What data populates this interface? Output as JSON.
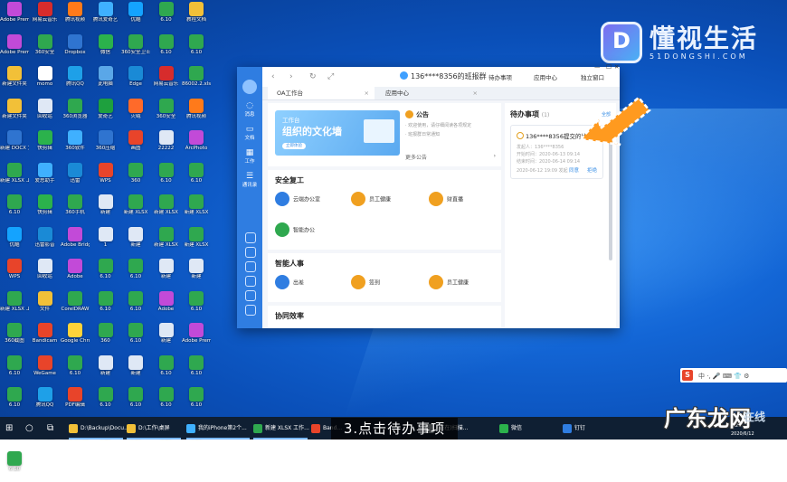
{
  "desktop": {
    "bg_color": "#1366d6",
    "icons": [
      [
        "Adobe Premiere",
        "#c24ad8"
      ],
      [
        "网易云音乐",
        "#d72c2c"
      ],
      [
        "腾讯视频",
        "#ff7a1a"
      ],
      [
        "腾讯爱奇艺",
        "#3fb0ff"
      ],
      [
        "优酷",
        "#14a3ff"
      ],
      [
        "6.10",
        "#2fa84f"
      ],
      [
        "教程文档",
        "#f2c038"
      ],
      [
        "Adobe Premiere",
        "#c24ad8"
      ],
      [
        "360安全",
        "#2fa84f"
      ],
      [
        "Dropbox",
        "#2f74d0"
      ],
      [
        "微信",
        "#2bb24c"
      ],
      [
        "360安全卫士",
        "#2fa84f"
      ],
      [
        "6.10",
        "#2fa84f"
      ],
      [
        "6.10",
        "#2fa84f"
      ],
      [
        "新建文件夹",
        "#f2c038"
      ],
      [
        "momo",
        "#ffffff"
      ],
      [
        "腾讯QQ",
        "#1ea0e8"
      ],
      [
        "此电脑",
        "#5aa7e8"
      ],
      [
        "Edge",
        "#1a8ad6"
      ],
      [
        "网易云音乐",
        "#d72c2c"
      ],
      [
        "86002.2.xlsx",
        "#2fa84f"
      ],
      [
        "新建文件夹",
        "#f2c038"
      ],
      [
        "回收站",
        "#dfe8f5"
      ],
      [
        "360浏览器",
        "#2fa84f"
      ],
      [
        "爱奇艺",
        "#1ea03e"
      ],
      [
        "火绒",
        "#ff6a2a"
      ],
      [
        "360安全",
        "#2fa84f"
      ],
      [
        "腾讯视频",
        "#ff7a1a"
      ],
      [
        "新建 DOCX 文档.docx",
        "#2f74d0"
      ],
      [
        "快剪辑",
        "#2bb24c"
      ],
      [
        "360软件",
        "#3fb0ff"
      ],
      [
        "360压缩",
        "#2f74d0"
      ],
      [
        "画图",
        "#e8442a"
      ],
      [
        "22222",
        "#dfe8f5"
      ],
      [
        "ArcPhoto",
        "#c24ad8"
      ],
      [
        "新建 XLSX 工作表",
        "#2fa84f"
      ],
      [
        "爱思助手",
        "#3fb0ff"
      ],
      [
        "迅雷",
        "#1a8ad6"
      ],
      [
        "WPS",
        "#e8442a"
      ],
      [
        "360",
        "#2fa84f"
      ],
      [
        "6.10",
        "#2fa84f"
      ],
      [
        "6.10",
        "#2fa84f"
      ],
      [
        "6.10",
        "#2fa84f"
      ],
      [
        "快剪辑",
        "#2bb24c"
      ],
      [
        "360手机",
        "#2fa84f"
      ],
      [
        "新建",
        "#dfe8f5"
      ],
      [
        "新建 XLSX",
        "#2fa84f"
      ],
      [
        "新建 XLSX",
        "#2fa84f"
      ],
      [
        "新建 XLSX",
        "#2fa84f"
      ],
      [
        "优酷",
        "#14a3ff"
      ],
      [
        "迅雷影音",
        "#1a8ad6"
      ],
      [
        "Adobe Bridge",
        "#c24ad8"
      ],
      [
        "1",
        "#dfe8f5"
      ],
      [
        "新建",
        "#dfe8f5"
      ],
      [
        "新建 XLSX",
        "#2fa84f"
      ],
      [
        "新建 XLSX",
        "#2fa84f"
      ],
      [
        "WPS",
        "#e8442a"
      ],
      [
        "回收站",
        "#dfe8f5"
      ],
      [
        "Adobe",
        "#c24ad8"
      ],
      [
        "6.10",
        "#2fa84f"
      ],
      [
        "6.10",
        "#2fa84f"
      ],
      [
        "新建",
        "#dfe8f5"
      ],
      [
        "新建",
        "#dfe8f5"
      ],
      [
        "新建 XLSX 工作表",
        "#2fa84f"
      ],
      [
        "文件",
        "#f2c038"
      ],
      [
        "CorelDRAW",
        "#2fa84f"
      ],
      [
        "6.10",
        "#2fa84f"
      ],
      [
        "6.10",
        "#2fa84f"
      ],
      [
        "Adobe",
        "#c24ad8"
      ],
      [
        "6.10",
        "#2fa84f"
      ],
      [
        "360截图",
        "#2fa84f"
      ],
      [
        "Bandicam",
        "#e8442a"
      ],
      [
        "Google Chrome",
        "#ffd33a"
      ],
      [
        "360",
        "#2fa84f"
      ],
      [
        "6.10",
        "#2fa84f"
      ],
      [
        "新建",
        "#dfe8f5"
      ],
      [
        "Adobe Premiere",
        "#c24ad8"
      ],
      [
        "6.10",
        "#2fa84f"
      ],
      [
        "WeGame",
        "#e8442a"
      ],
      [
        "6.10",
        "#2fa84f"
      ],
      [
        "新建",
        "#dfe8f5"
      ],
      [
        "新建",
        "#dfe8f5"
      ],
      [
        "6.10",
        "#2fa84f"
      ],
      [
        "6.10",
        "#2fa84f"
      ],
      [
        "6.10",
        "#2fa84f"
      ],
      [
        "腾讯QQ",
        "#1ea0e8"
      ],
      [
        "PDF编辑",
        "#e8442a"
      ],
      [
        "6.10",
        "#2fa84f"
      ],
      [
        "6.10",
        "#2fa84f"
      ],
      [
        "6.10",
        "#2fa84f"
      ],
      [
        "6.10",
        "#2fa84f"
      ],
      [
        "6.10",
        "#2fa84f"
      ],
      [
        "腾讯视频",
        "#ff7a1a"
      ],
      [
        "WPS Office",
        "#e8442a"
      ],
      [
        "6.10",
        "#2fa84f"
      ],
      [
        "6.10",
        "#2fa84f"
      ],
      [
        "6.10",
        "#2fa84f"
      ],
      [
        "6.10",
        "#2fa84f"
      ],
      [
        "6.10",
        "#2fa84f"
      ]
    ]
  },
  "watermark": {
    "logo_letter": "D",
    "title": "懂视生活",
    "domain": "51DONGSHI.COM"
  },
  "app": {
    "sidebar": [
      {
        "icon": "chat-icon",
        "label": "消息"
      },
      {
        "icon": "doc-icon",
        "label": "文档"
      },
      {
        "icon": "grid-icon",
        "label": "工作"
      },
      {
        "icon": "contacts-icon",
        "label": "通讯录"
      }
    ],
    "nav": {
      "back": "‹",
      "forward": "›",
      "refresh": "↻",
      "expand": "⤢"
    },
    "user": "136****8356的班报群",
    "toolbar": {
      "todo": "待办事项",
      "apps": "应用中心",
      "standalone": "独立窗口"
    },
    "window": {
      "minimize": "—",
      "maximize": "☐",
      "close": "✕"
    },
    "tabs": [
      {
        "label": "OA工作台",
        "active": true
      },
      {
        "label": "应用中心",
        "active": false
      }
    ],
    "tab_close": "×",
    "banner": {
      "line1": "工作台",
      "line2": "组织的文化墙",
      "button": "立即体验"
    },
    "announce": {
      "title": "公告",
      "lines": [
        "· 欢迎使用，请仔细阅读各项规定",
        "· 班报群日常通知"
      ],
      "footer": "更多公告",
      "arrow": "›"
    },
    "sections": [
      {
        "title": "安全复工",
        "items": [
          {
            "label": "云端办公室",
            "color": "#2f7de1"
          },
          {
            "label": "员工健康",
            "color": "#f0a020"
          },
          {
            "label": "财直播",
            "color": "#f0a020"
          },
          {
            "label": "智能办公",
            "color": "#2fa84f"
          }
        ]
      },
      {
        "title": "智能人事",
        "items": [
          {
            "label": "出差",
            "color": "#2f7de1"
          },
          {
            "label": "签到",
            "color": "#f0a020"
          },
          {
            "label": "员工健康",
            "color": "#f0a020"
          }
        ]
      },
      {
        "title": "协同效率",
        "items": []
      }
    ],
    "todo": {
      "title": "待办事项",
      "count": "(1)",
      "all": "全部",
      "card": {
        "title": "136****8356提交的比同",
        "lines": [
          "发起人：136****8356",
          "开始时间：2020-06-13 09:14",
          "结束时间：2020-06-14 09:14",
          "2020-06-12 19:09 发起"
        ],
        "btn1": "同意",
        "btn2": "拒绝"
      }
    }
  },
  "tray": {
    "logo": "S",
    "text": "中 ·, 🎤 ⌨ 👕 ⚙"
  },
  "taskbar": {
    "items": [
      {
        "label": "⊞",
        "color": "#ffffff"
      },
      {
        "label": "○",
        "color": "#ffffff"
      },
      {
        "label": "⧉",
        "color": "#ffffff"
      },
      {
        "label": "D:\\Backup\\Docu...",
        "color": "#f2c038"
      },
      {
        "label": "D:\\工作\\桌屏",
        "color": "#f2c038"
      },
      {
        "label": "我的iPhone第2个...",
        "color": "#3fb0ff"
      },
      {
        "label": "新建 XLSX 工作...",
        "color": "#2fa84f"
      },
      {
        "label": "Band...",
        "color": "#e8442a"
      },
      {
        "label": "(正在)扫描...",
        "color": "#dfe8f5"
      },
      {
        "label": "微信",
        "color": "#2bb24c"
      },
      {
        "label": "钉钉",
        "color": "#2f7de1"
      }
    ],
    "clock": "9:26",
    "date": "2020/6/12"
  },
  "caption": "3.点击待办事项",
  "site_watermark": {
    "main": "广东龙网",
    "sub": "在线"
  }
}
